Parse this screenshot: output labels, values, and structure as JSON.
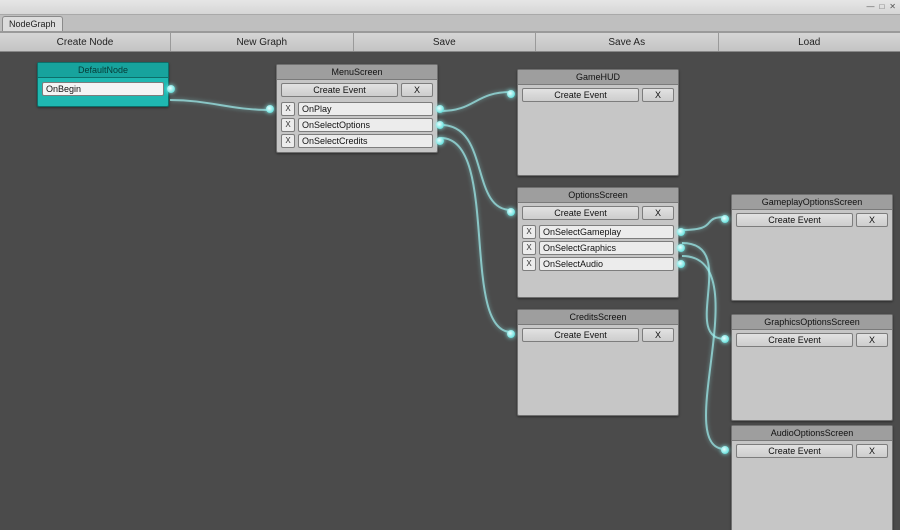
{
  "window": {
    "tab": "NodeGraph"
  },
  "toolbar": {
    "create_node": "Create Node",
    "new_graph": "New Graph",
    "save": "Save",
    "save_as": "Save As",
    "load": "Load"
  },
  "labels": {
    "create_event": "Create Event",
    "x": "X"
  },
  "nodes": {
    "default": {
      "title": "DefaultNode",
      "events": [
        "OnBegin"
      ]
    },
    "menu": {
      "title": "MenuScreen",
      "events": [
        "OnPlay",
        "OnSelectOptions",
        "OnSelectCredits"
      ]
    },
    "gamehud": {
      "title": "GameHUD",
      "events": []
    },
    "options": {
      "title": "OptionsScreen",
      "events": [
        "OnSelectGameplay",
        "OnSelectGraphics",
        "OnSelectAudio"
      ]
    },
    "credits": {
      "title": "CreditsScreen",
      "events": []
    },
    "gameplayopt": {
      "title": "GameplayOptionsScreen",
      "events": []
    },
    "graphicsopt": {
      "title": "GraphicsOptionsScreen",
      "events": []
    },
    "audioopt": {
      "title": "AudioOptionsScreen",
      "events": []
    }
  },
  "colors": {
    "accent": "#1fb8b1",
    "wire": "#9ff0ef",
    "canvas": "#4b4b4b"
  }
}
